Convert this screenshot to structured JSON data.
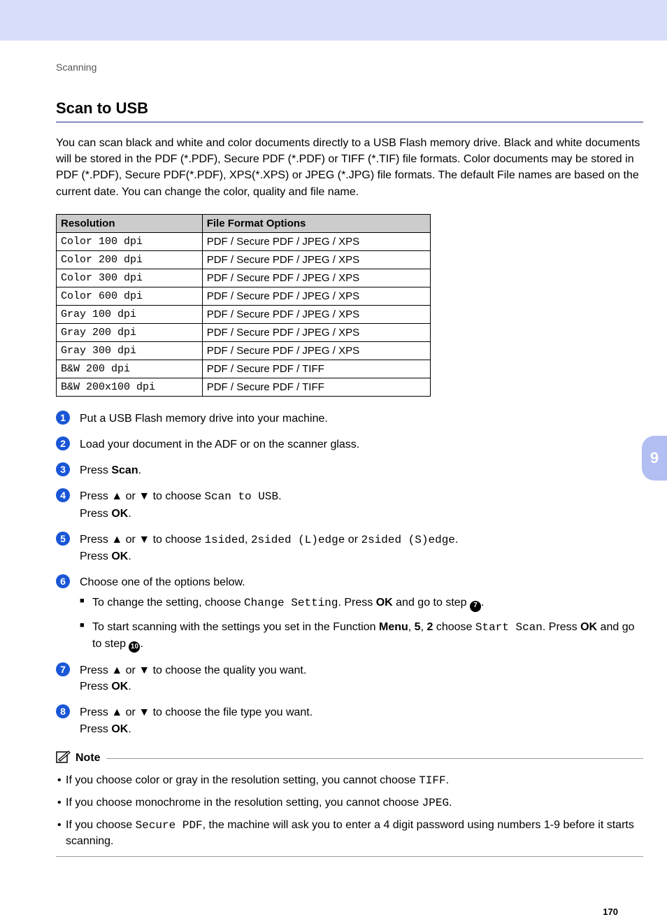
{
  "breadcrumb": "Scanning",
  "sidemark": "9",
  "page_number": "170",
  "heading": "Scan to USB",
  "intro": "You can scan black and white and color documents directly to a USB Flash memory drive. Black and white documents will be stored in the PDF (*.PDF), Secure PDF (*.PDF) or TIFF (*.TIF) file formats. Color documents may be stored in PDF (*.PDF), Secure PDF(*.PDF), XPS(*.XPS) or JPEG (*.JPG) file formats. The default File names are based on the current date. You can change the color, quality and file name.",
  "table": {
    "head": {
      "col1": "Resolution",
      "col2": "File Format Options"
    },
    "rows": [
      {
        "res": "Color 100 dpi",
        "fmt": "PDF / Secure PDF / JPEG / XPS"
      },
      {
        "res": "Color 200 dpi",
        "fmt": "PDF / Secure PDF / JPEG / XPS"
      },
      {
        "res": "Color 300 dpi",
        "fmt": "PDF / Secure PDF / JPEG / XPS"
      },
      {
        "res": "Color 600 dpi",
        "fmt": "PDF / Secure PDF / JPEG / XPS"
      },
      {
        "res": "Gray 100 dpi",
        "fmt": "PDF / Secure PDF / JPEG / XPS"
      },
      {
        "res": "Gray 200 dpi",
        "fmt": "PDF / Secure PDF / JPEG / XPS"
      },
      {
        "res": "Gray 300 dpi",
        "fmt": "PDF / Secure PDF / JPEG / XPS"
      },
      {
        "res": "B&W 200 dpi",
        "fmt": "PDF / Secure PDF / TIFF"
      },
      {
        "res": "B&W 200x100 dpi",
        "fmt": "PDF / Secure PDF / TIFF"
      }
    ]
  },
  "steps": {
    "s1": "Put a USB Flash memory drive into your machine.",
    "s2": "Load your document in the ADF or on the scanner glass.",
    "s3_prefix": "Press ",
    "s3_bold": "Scan",
    "s3_suffix": ".",
    "s4_a": "Press ",
    "s4_b": " or ",
    "s4_c": " to choose ",
    "s4_mono": "Scan to USB",
    "s4_d": ".",
    "s4_line2a": "Press ",
    "s4_line2b": "OK",
    "s4_line2c": ".",
    "s5_a": "Press ",
    "s5_b": " or ",
    "s5_c": " to choose ",
    "s5_m1": "1sided",
    "s5_d": ", ",
    "s5_m2": "2sided (L)edge",
    "s5_e": " or ",
    "s5_m3": "2sided (S)edge",
    "s5_f": ".",
    "s5_line2a": "Press ",
    "s5_line2b": "OK",
    "s5_line2c": ".",
    "s6": "Choose one of the options below.",
    "s6_sub1_a": "To change the setting, choose ",
    "s6_sub1_mono": "Change Setting",
    "s6_sub1_b": ". Press ",
    "s6_sub1_bold": "OK",
    "s6_sub1_c": " and go to step ",
    "s6_sub1_ref": "7",
    "s6_sub1_d": ".",
    "s6_sub2_a": "To start scanning with the settings you set in the Function ",
    "s6_sub2_b1": "Menu",
    "s6_sub2_comma1": ", ",
    "s6_sub2_b2": "5",
    "s6_sub2_comma2": ", ",
    "s6_sub2_b3": "2",
    "s6_sub2_c": " choose ",
    "s6_sub2_mono": "Start Scan",
    "s6_sub2_d": ". Press ",
    "s6_sub2_bold": "OK",
    "s6_sub2_e": " and go to step ",
    "s6_sub2_ref": "10",
    "s6_sub2_f": ".",
    "s7_a": "Press ",
    "s7_b": " or ",
    "s7_c": " to choose the quality you want.",
    "s7_line2a": "Press ",
    "s7_line2b": "OK",
    "s7_line2c": ".",
    "s8_a": "Press ",
    "s8_b": " or ",
    "s8_c": " to choose the file type you want.",
    "s8_line2a": "Press ",
    "s8_line2b": "OK",
    "s8_line2c": "."
  },
  "glyph": {
    "up": "▲",
    "down": "▼"
  },
  "note": {
    "label": "Note",
    "n1_a": "If you choose color or gray in the resolution setting, you cannot choose ",
    "n1_mono": "TIFF",
    "n1_b": ".",
    "n2_a": "If you choose monochrome in the resolution setting, you cannot choose ",
    "n2_mono": "JPEG",
    "n2_b": ".",
    "n3_a": "If you choose ",
    "n3_mono": "Secure PDF",
    "n3_b": ", the machine will ask you to enter a 4 digit password using numbers 1-9 before it starts scanning."
  }
}
